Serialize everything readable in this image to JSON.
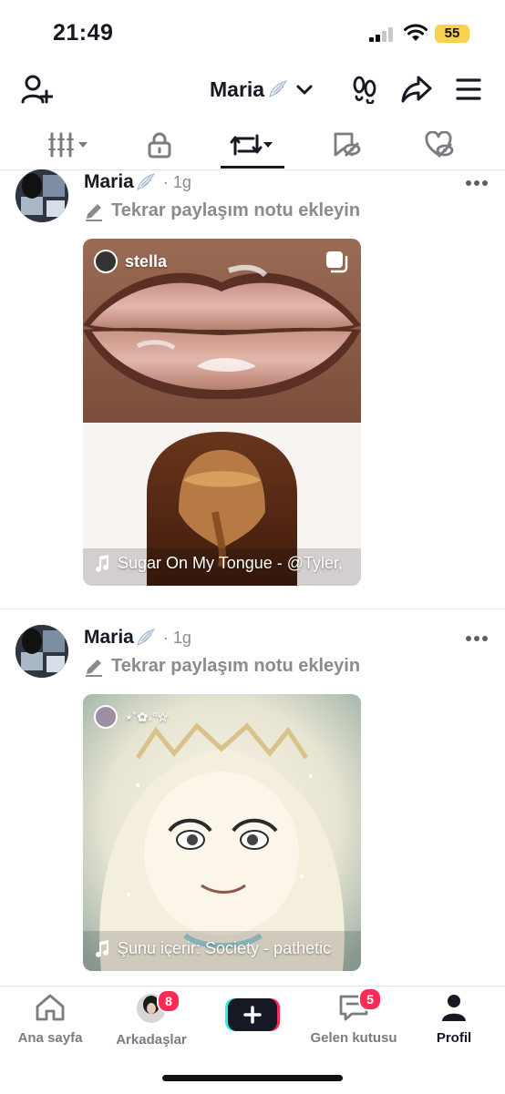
{
  "status_bar": {
    "time": "21:49",
    "battery": "55"
  },
  "header": {
    "title": "Maria"
  },
  "posts": [
    {
      "name": "Maria",
      "time": "· 1g",
      "note": "Tekrar paylaşım notu ekleyin",
      "card_user": "stella",
      "music": "Sugar On My Tongue - @Tyler,"
    },
    {
      "name": "Maria",
      "time": "· 1g",
      "note": "Tekrar paylaşım notu ekleyin",
      "card_user": "⋆˚✿˖°☆",
      "music": "Şunu içerir: Society - pathetic"
    }
  ],
  "bottom_nav": {
    "home": "Ana sayfa",
    "friends": "Arkadaşlar",
    "friends_badge": "8",
    "inbox": "Gelen kutusu",
    "inbox_badge": "5",
    "profile": "Profil"
  },
  "colors": {
    "accent_red": "#fe2c55",
    "accent_cyan": "#25f4ee",
    "battery": "#f6d34b"
  }
}
